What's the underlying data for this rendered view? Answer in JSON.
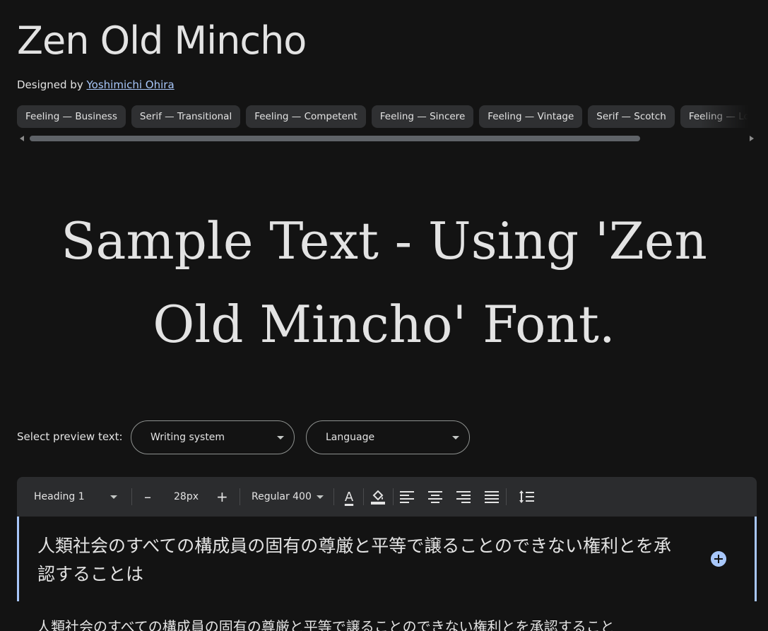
{
  "font": {
    "title": "Zen Old Mincho",
    "designed_by_label": "Designed by",
    "designer_name": "Yoshimichi Ohira"
  },
  "tags": [
    "Feeling — Business",
    "Serif — Transitional",
    "Feeling — Competent",
    "Feeling — Sincere",
    "Feeling — Vintage",
    "Serif — Scotch",
    "Feeling — Lo"
  ],
  "hero": {
    "sample_text": "Sample Text - Using 'Zen Old Mincho' Font."
  },
  "preview": {
    "label": "Select preview text:",
    "writing_system": "Writing system",
    "language": "Language"
  },
  "toolbar": {
    "style": "Heading 1",
    "decrease": "–",
    "size": "28px",
    "increase": "+",
    "weight": "Regular 400",
    "text_color_glyph": "A"
  },
  "editor": {
    "heading_text": "人類社会のすべての構成員の固有の尊厳と平等で譲ることのできない権利とを承認することは",
    "body_text": "人類社会のすべての構成員の固有の尊厳と平等で譲ることのできない権利とを承認すること"
  },
  "colors": {
    "background": "#131313",
    "text": "#e3e3e3",
    "link": "#a8c7fa",
    "chip": "#2f3032",
    "toolbar": "#2b2c2e",
    "accent": "#a8c7fa"
  }
}
